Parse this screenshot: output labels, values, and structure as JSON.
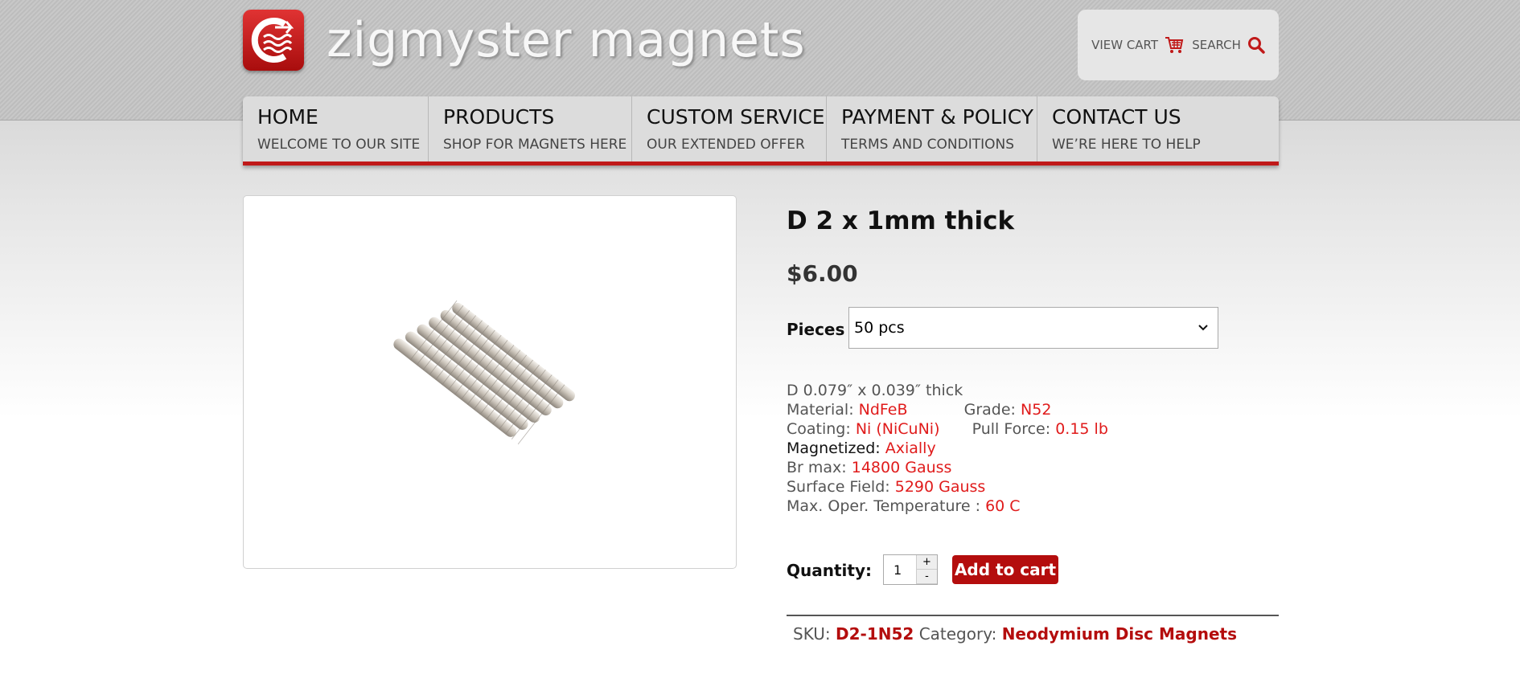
{
  "brand": {
    "name": "zigmyster magnets"
  },
  "header_tools": {
    "view_cart": "VIEW CART",
    "search": "SEARCH"
  },
  "nav": [
    {
      "title": "HOME",
      "subtitle": "WELCOME TO OUR SITE"
    },
    {
      "title": "PRODUCTS",
      "subtitle": "SHOP FOR MAGNETS HERE"
    },
    {
      "title": "CUSTOM SERVICE",
      "subtitle": "OUR EXTENDED OFFER"
    },
    {
      "title": "PAYMENT & POLICY",
      "subtitle": "TERMS AND CONDITIONS"
    },
    {
      "title": "CONTACT US",
      "subtitle": "WE’RE HERE TO HELP"
    }
  ],
  "product": {
    "title": "D 2 x 1mm thick",
    "price": "$6.00",
    "pieces_label": "Pieces",
    "pieces_selected": "50 pcs",
    "specs": {
      "dimensions": "D 0.079″ x 0.039″ thick",
      "material_label": "Material:",
      "material": "NdFeB",
      "grade_label": "Grade:",
      "grade": "N52",
      "coating_label": "Coating:",
      "coating": "Ni (NiCuNi)",
      "pull_force_label": "Pull Force:",
      "pull_force": "0.15 lb",
      "magnetized_label": "Magnetized:",
      "magnetized": "Axially",
      "br_max_label": "Br max:",
      "br_max": "14800 Gauss",
      "surface_field_label": "Surface Field:",
      "surface_field": "5290 Gauss",
      "max_temp_label": "Max. Oper. Temperature :",
      "max_temp": "60 C"
    },
    "quantity_label": "Quantity:",
    "quantity_value": "1",
    "qty_plus": "+",
    "qty_minus": "-",
    "add_to_cart": "Add to cart",
    "sku_label": "SKU:",
    "sku": "D2-1N52",
    "category_label": "Category:",
    "category": "Neodymium Disc Magnets"
  },
  "colors": {
    "accent_red": "#c01919",
    "spec_red": "#e01b1b",
    "button_red": "#b40d0d"
  }
}
